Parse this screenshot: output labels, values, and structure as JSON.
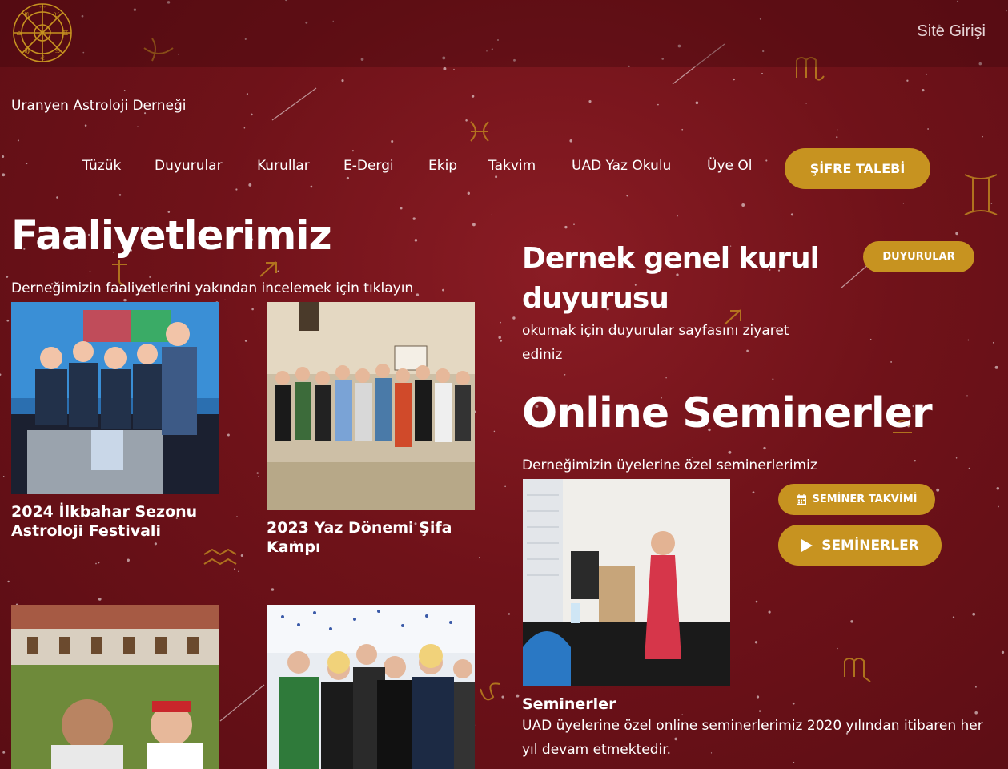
{
  "header": {
    "site_login": "Site Girişi",
    "site_name": "Uranyen Astroloji Derneği",
    "logo_icon": "zodiac-wheel-logo"
  },
  "nav": {
    "items": [
      "Tüzük",
      "Duyurular",
      "Kurullar",
      "E-Dergi",
      "Ekip",
      "Takvim",
      "UAD Yaz Okulu",
      "Üye Ol"
    ],
    "password_button": "ŞİFRE TALEBİ"
  },
  "activities": {
    "title": "Faaliyetlerimiz",
    "subtitle": "Derneğimizin faaliyetlerini yakından incelemek için tıklayın",
    "cards": [
      {
        "title": "2024 İlkbahar Sezonu Astroloji Festivali",
        "image": "group-photo-party"
      },
      {
        "title": "2023 Yaz Dönemi Şifa Kampı",
        "image": "group-photo-camp"
      },
      {
        "title": "",
        "image": "outdoor-selfie-photo"
      },
      {
        "title": "",
        "image": "group-photo-event"
      }
    ]
  },
  "announcement": {
    "title": "Dernek genel kurul duyurusu",
    "text": "okumak için duyurular sayfasını ziyaret ediniz",
    "button": "DUYURULAR"
  },
  "seminars": {
    "title": "Online Seminerler",
    "subtitle": "Derneğimizin üyelerine özel seminerlerimiz",
    "calendar_button": "SEMİNER TAKVİMİ",
    "calendar_icon": "calendar-icon",
    "seminars_button": "SEMİNERLER",
    "play_icon": "play-icon",
    "card_title": "Seminerler",
    "card_text": "UAD üyelerine özel online seminerlerimiz 2020 yılından itibaren her yıl devam etmektedir."
  },
  "colors": {
    "background": "#6f1219",
    "gold": "#c79320",
    "text": "#ffffff"
  }
}
